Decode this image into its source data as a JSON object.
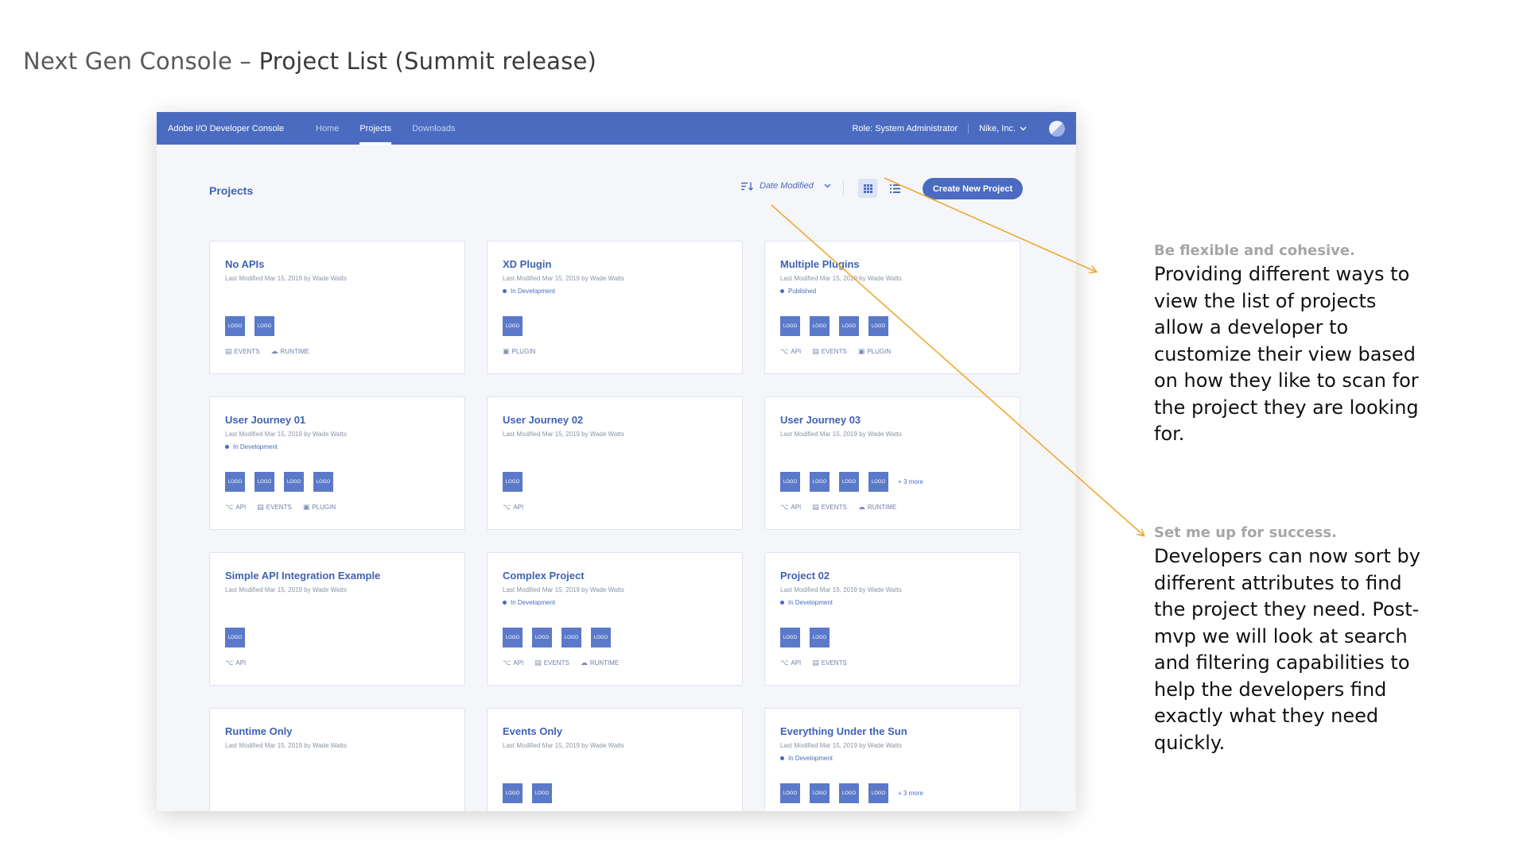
{
  "slide": {
    "title_light": "Next Gen Console –",
    "title_strong": "Project List (Summit release)"
  },
  "topnav": {
    "brand": "Adobe I/O Developer Console",
    "links": [
      "Home",
      "Projects",
      "Downloads"
    ],
    "active_link": "Projects",
    "role": "Role: System Administrator",
    "org": "Nike, Inc.",
    "org_icon": "chevron-down-icon",
    "avatar_icon": "avatar-icon"
  },
  "toolbar": {
    "page_heading": "Projects",
    "sort_label": "Date Modified",
    "sort_icon": "sort-icon",
    "view_grid_icon": "grid-view-icon",
    "view_list_icon": "list-view-icon",
    "active_view": "grid",
    "create_button": "Create New Project"
  },
  "cards": [
    {
      "title": "No APIs",
      "meta": "Last Modified Mar 15, 2019 by Wade Watts",
      "status": "",
      "logos": [
        "LOGO",
        "LOGO"
      ],
      "more": "",
      "tags": [
        "EVENTS",
        "RUNTIME"
      ]
    },
    {
      "title": "XD Plugin",
      "meta": "Last Modified Mar 15, 2019 by Wade Watts",
      "status": "In Development",
      "logos": [
        "LOGO"
      ],
      "more": "",
      "tags": [
        "PLUGIN"
      ]
    },
    {
      "title": "Multiple Plugins",
      "meta": "Last Modified Mar 15, 2019 by Wade Watts",
      "status": "Published",
      "logos": [
        "LOGO",
        "LOGO",
        "LOGO",
        "LOGO"
      ],
      "more": "",
      "tags": [
        "API",
        "EVENTS",
        "PLUGIN"
      ]
    },
    {
      "title": "User Journey 01",
      "meta": "Last Modified Mar 15, 2019 by Wade Watts",
      "status": "In Development",
      "logos": [
        "LOGO",
        "LOGO",
        "LOGO",
        "LOGO"
      ],
      "more": "",
      "tags": [
        "API",
        "EVENTS",
        "PLUGIN"
      ]
    },
    {
      "title": "User Journey 02",
      "meta": "Last Modified Mar 15, 2019 by Wade Watts",
      "status": "",
      "logos": [
        "LOGO"
      ],
      "more": "",
      "tags": [
        "API"
      ]
    },
    {
      "title": "User Journey 03",
      "meta": "Last Modified Mar 15, 2019 by Wade Watts",
      "status": "",
      "logos": [
        "LOGO",
        "LOGO",
        "LOGO",
        "LOGO"
      ],
      "more": "+ 3 more",
      "tags": [
        "API",
        "EVENTS",
        "RUNTIME"
      ]
    },
    {
      "title": "Simple API Integration Example",
      "meta": "Last Modified Mar 15, 2019 by Wade Watts",
      "status": "",
      "logos": [
        "LOGO"
      ],
      "more": "",
      "tags": [
        "API"
      ]
    },
    {
      "title": "Complex Project",
      "meta": "Last Modified Mar 15, 2019 by Wade Watts",
      "status": "In Development",
      "logos": [
        "LOGO",
        "LOGO",
        "LOGO",
        "LOGO"
      ],
      "more": "",
      "tags": [
        "API",
        "EVENTS",
        "RUNTIME"
      ]
    },
    {
      "title": "Project 02",
      "meta": "Last Modified Mar 15, 2019 by Wade Watts",
      "status": "In Development",
      "logos": [
        "LOGO",
        "LOGO"
      ],
      "more": "",
      "tags": [
        "API",
        "EVENTS"
      ]
    },
    {
      "title": "Runtime Only",
      "meta": "Last Modified Mar 15, 2019 by Wade Watts",
      "status": "",
      "logos": [],
      "more": "",
      "tags": []
    },
    {
      "title": "Events Only",
      "meta": "Last Modified Mar 15, 2019 by Wade Watts",
      "status": "",
      "logos": [
        "LOGO",
        "LOGO"
      ],
      "more": "",
      "tags": []
    },
    {
      "title": "Everything Under the Sun",
      "meta": "Last Modified Mar 15, 2019 by Wade Watts",
      "status": "In Development",
      "logos": [
        "LOGO",
        "LOGO",
        "LOGO",
        "LOGO"
      ],
      "more": "+ 3 more",
      "tags": []
    }
  ],
  "annotations": [
    {
      "heading": "Be flexible and cohesive.",
      "body": "Providing different ways to view the list of projects allow a developer to customize their view based on how they like to scan for the project they are looking for."
    },
    {
      "heading": "Set me up for success.",
      "body": "Developers can now sort by different attributes to find the project they need. Post-mvp we will look at search and filtering capabilities to help the developers find exactly what they need quickly."
    }
  ],
  "colors": {
    "nav": "#4a6bc0",
    "accent": "#3f62b5",
    "logo_tile": "#5b79c9",
    "arrow": "#f0a830",
    "note_heading": "#a6a6a6"
  }
}
